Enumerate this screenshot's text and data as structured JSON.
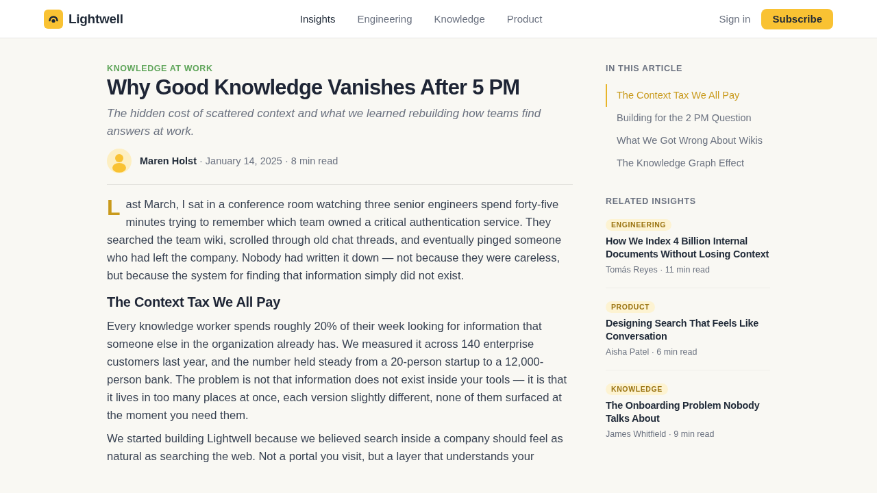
{
  "header": {
    "brand": "Lightwell",
    "nav": [
      {
        "label": "Insights",
        "selected": true
      },
      {
        "label": "Engineering",
        "selected": false
      },
      {
        "label": "Knowledge",
        "selected": false
      },
      {
        "label": "Product",
        "selected": false
      }
    ],
    "sign_in": "Sign in",
    "subscribe": "Subscribe"
  },
  "article": {
    "kicker": "KNOWLEDGE AT WORK",
    "title": "Why Good Knowledge Vanishes After 5 PM",
    "subtitle": "The hidden cost of scattered context and what we learned rebuilding how teams find answers at work.",
    "author": {
      "name": "Maren Holst",
      "meta": "· January 14, 2025 · 8 min read"
    },
    "body": [
      {
        "kind": "lead",
        "text": "Last March, I sat in a conference room watching three senior engineers spend forty-five minutes trying to remember which team owned a critical authentication service. They searched the team wiki, scrolled through old chat threads, and eventually pinged someone who had left the company. Nobody had written it down — not because they were careless, but because the system for finding that information simply did not exist."
      },
      {
        "kind": "heading",
        "text": "The Context Tax We All Pay"
      },
      {
        "kind": "paragraph",
        "text": "Every knowledge worker spends roughly 20% of their week looking for information that someone else in the organization already has. We measured it across 140 enterprise customers last year, and the number held steady from a 20-person startup to a 12,000-person bank. The problem is not that information does not exist inside your tools — it is that it lives in too many places at once, each version slightly different, none of them surfaced at the moment you need them."
      },
      {
        "kind": "paragraph",
        "text": "We started building Lightwell because we believed search inside a company should feel as natural as searching the web. Not a portal you visit, but a layer that understands your"
      }
    ]
  },
  "sidebar": {
    "toc": {
      "heading": "IN THIS ARTICLE",
      "items": [
        {
          "label": "The Context Tax We All Pay",
          "selected": true
        },
        {
          "label": "Building for the 2 PM Question",
          "selected": false
        },
        {
          "label": "What We Got Wrong About Wikis",
          "selected": false
        },
        {
          "label": "The Knowledge Graph Effect",
          "selected": false
        }
      ]
    },
    "related": {
      "heading": "RELATED INSIGHTS",
      "items": [
        {
          "tag": "ENGINEERING",
          "title": "How We Index 4 Billion Internal Documents Without Losing Context",
          "meta": "Tomás Reyes · 11 min read"
        },
        {
          "tag": "PRODUCT",
          "title": "Designing Search That Feels Like Conversation",
          "meta": "Aisha Patel · 6 min read"
        },
        {
          "tag": "KNOWLEDGE",
          "title": "The Onboarding Problem Nobody Talks About",
          "meta": "James Whitfield · 9 min read"
        }
      ]
    }
  }
}
